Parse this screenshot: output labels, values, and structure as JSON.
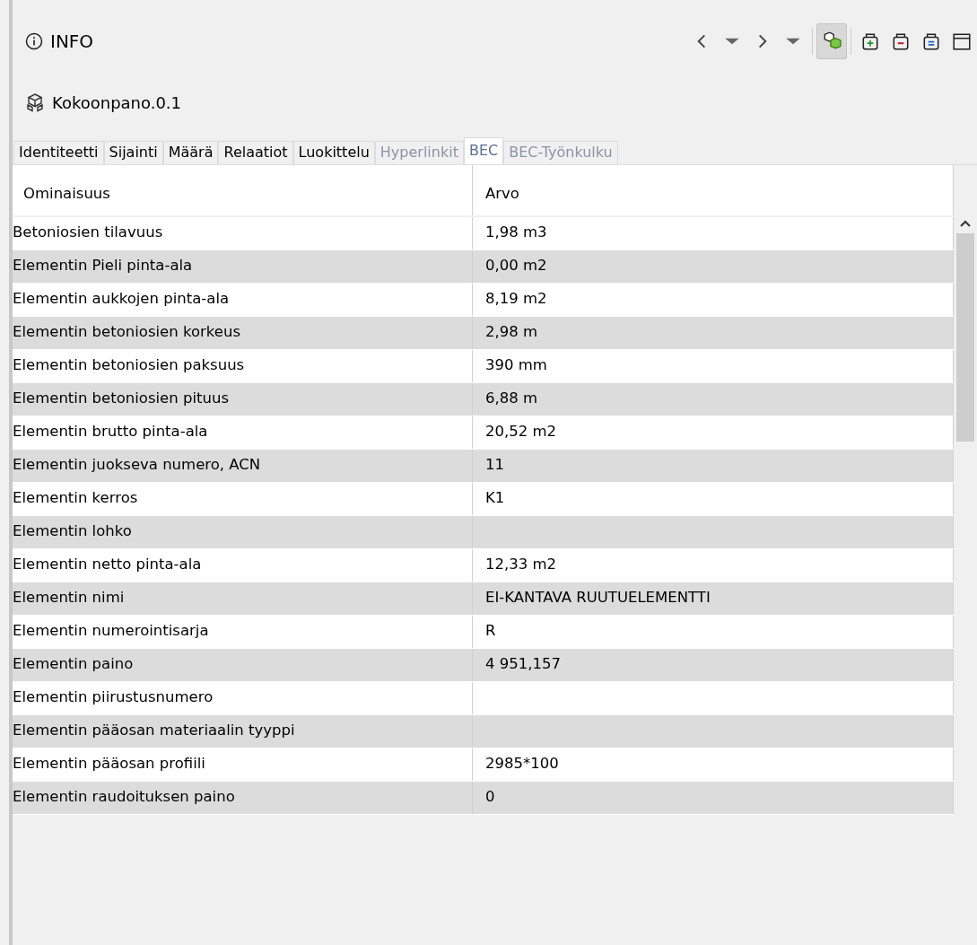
{
  "panel": {
    "title": "INFO"
  },
  "toolbar": [
    {
      "kind": "back",
      "pressed": false
    },
    {
      "kind": "dropdown",
      "pressed": false
    },
    {
      "kind": "forward",
      "pressed": false
    },
    {
      "kind": "dropdown",
      "pressed": false
    },
    {
      "kind": "cubes",
      "pressed": true
    },
    {
      "kind": "add",
      "pressed": false
    },
    {
      "kind": "remove",
      "pressed": false
    },
    {
      "kind": "equal",
      "pressed": false
    },
    {
      "kind": "window",
      "pressed": false
    }
  ],
  "object": {
    "name": "Kokoonpano.0.1"
  },
  "tabs": [
    {
      "label": "Identiteetti",
      "selected": false,
      "disabled": false
    },
    {
      "label": "Sijainti",
      "selected": false,
      "disabled": false
    },
    {
      "label": "Määrä",
      "selected": false,
      "disabled": false
    },
    {
      "label": "Relaatiot",
      "selected": false,
      "disabled": false
    },
    {
      "label": "Luokittelu",
      "selected": false,
      "disabled": false
    },
    {
      "label": "Hyperlinkit",
      "selected": false,
      "disabled": true
    },
    {
      "label": "BEC",
      "selected": true,
      "disabled": false
    },
    {
      "label": "BEC-Työnkulku",
      "selected": false,
      "disabled": true
    }
  ],
  "table": {
    "columns": [
      "Ominaisuus",
      "Arvo"
    ],
    "rows": [
      [
        "Betoniosien tilavuus",
        "1,98 m3"
      ],
      [
        "Elementin Pieli pinta-ala",
        "0,00 m2"
      ],
      [
        "Elementin aukkojen pinta-ala",
        "8,19 m2"
      ],
      [
        "Elementin betoniosien korkeus",
        "2,98 m"
      ],
      [
        "Elementin betoniosien paksuus",
        "390 mm"
      ],
      [
        "Elementin betoniosien pituus",
        "6,88 m"
      ],
      [
        "Elementin brutto pinta-ala",
        "20,52 m2"
      ],
      [
        "Elementin juokseva numero, ACN",
        "11"
      ],
      [
        "Elementin kerros",
        "K1"
      ],
      [
        "Elementin lohko",
        ""
      ],
      [
        "Elementin netto pinta-ala",
        "12,33 m2"
      ],
      [
        "Elementin nimi",
        "EI-KANTAVA RUUTUELEMENTTI"
      ],
      [
        "Elementin numerointisarja",
        "R"
      ],
      [
        "Elementin paino",
        "4 951,157"
      ],
      [
        "Elementin piirustusnumero",
        ""
      ],
      [
        "Elementin pääosan materiaalin tyyppi",
        ""
      ],
      [
        "Elementin pääosan profiili",
        "2985*100"
      ],
      [
        "Elementin raudoituksen paino",
        "0"
      ]
    ]
  }
}
